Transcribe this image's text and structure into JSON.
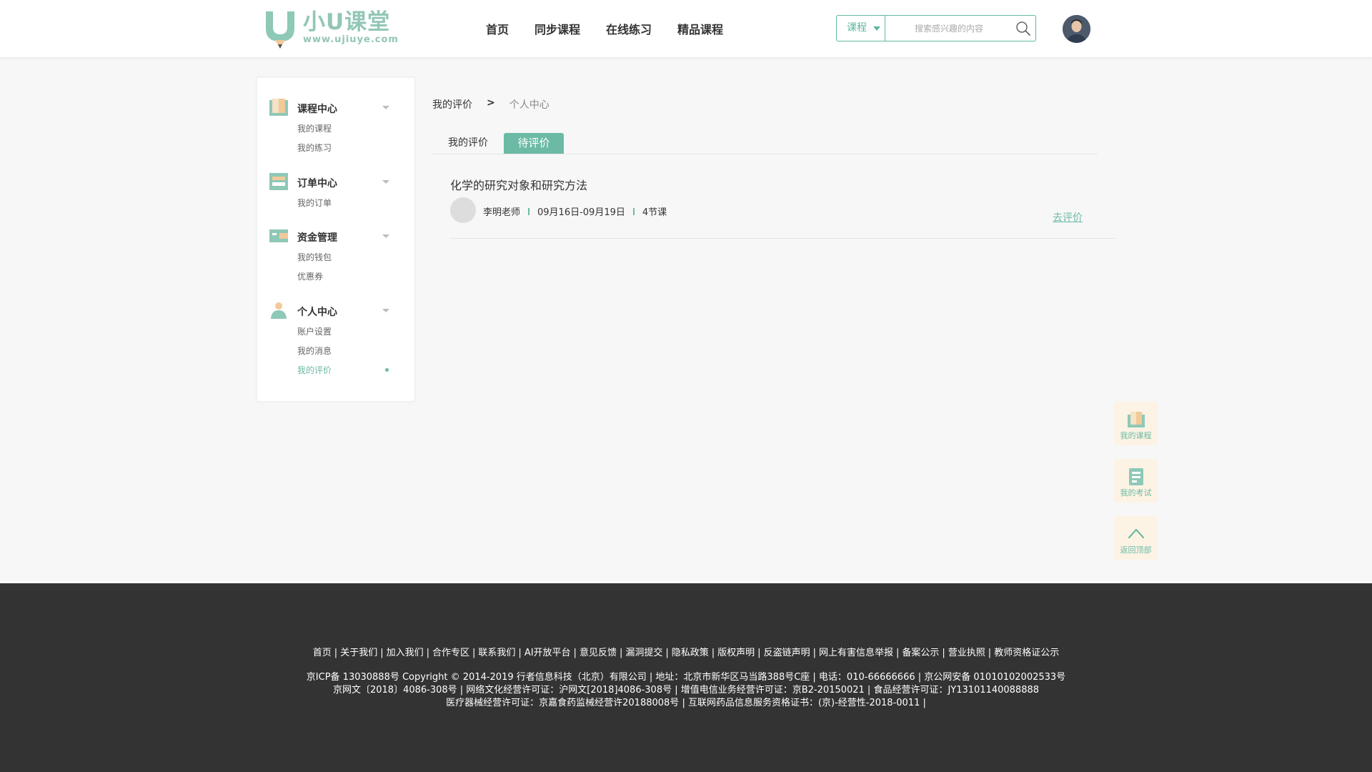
{
  "header": {
    "logo_name": "小U课堂",
    "logo_url": "www.ujiuye.com",
    "nav": [
      "首页",
      "同步课程",
      "在线练习",
      "精品课程"
    ],
    "search": {
      "category": "课程",
      "placeholder": "搜索感兴趣的内容"
    }
  },
  "sidebar": {
    "groups": [
      {
        "title": "课程中心",
        "icon": "book-icon",
        "items": [
          "我的课程",
          "我的练习"
        ]
      },
      {
        "title": "订单中心",
        "icon": "order-icon",
        "items": [
          "我的订单"
        ]
      },
      {
        "title": "资金管理",
        "icon": "wallet-icon",
        "items": [
          "我的钱包",
          "优惠券"
        ]
      },
      {
        "title": "个人中心",
        "icon": "person-icon",
        "items": [
          "账户设置",
          "我的消息",
          "我的评价"
        ]
      }
    ],
    "active_item": "我的评价"
  },
  "breadcrumb": {
    "first": "我的评价",
    "separator": ">",
    "current": "个人中心"
  },
  "tabs": [
    "我的评价",
    "待评价"
  ],
  "active_tab": "待评价",
  "course": {
    "title": "化学的研究对象和研究方法",
    "teacher": "李明老师",
    "dates": "09月16日-09月19日",
    "lessons": "4节课",
    "action": "去评价"
  },
  "floating": [
    {
      "label": "我的课程",
      "icon": "course-book-icon"
    },
    {
      "label": "我的考试",
      "icon": "exam-icon"
    },
    {
      "label": "返回顶部",
      "icon": "up-arrow-icon"
    }
  ],
  "footer": {
    "links": [
      "首页",
      "关于我们",
      "加入我们",
      "合作专区",
      "联系我们",
      "AI开放平台",
      "意见反馈",
      "漏洞提交",
      "隐私政策",
      "版权声明",
      "反盗链声明",
      "网上有害信息举报",
      "备案公示",
      "营业执照",
      "教师资格证公示"
    ],
    "line1": "京ICP备 13030888号 Copyright © 2014-2019 行者信息科技（北京）有限公司 | 地址：北京市新华区马当路388号C座 | 电话：010-66666666 |  京公网安备 01010102002533号",
    "line2": "京网文〔2018〕4086-308号 | 网络文化经营许可证：沪网文[2018]4086-308号 | 增值电信业务经营许可证：京B2-20150021 | 食品经营许可证：JY13101140088888",
    "line3": "医疗器械经营许可证：京嘉食药监械经营许20188008号 | 互联网药品信息服务资格证书：(京)-经营性-2018-0011 |"
  },
  "colors": {
    "accent": "#6cbaa5",
    "footer_bg": "#333333",
    "float_bg": "#fdf3e4"
  }
}
